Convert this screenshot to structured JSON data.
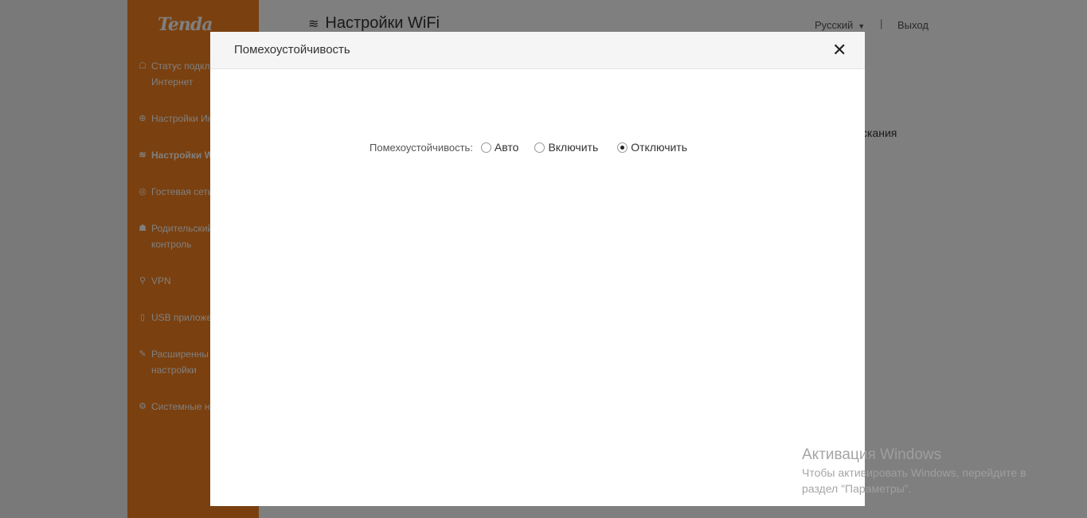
{
  "app": {
    "logo": "Tenda",
    "page_title": "Настройки WiFi",
    "language": "Русский",
    "separator": "|",
    "logout": "Выход",
    "background_fragment": "скания"
  },
  "sidebar": {
    "items": [
      {
        "icon": "network-status-icon",
        "glyph": "☖",
        "label": "Статус подкл\nИнтернет"
      },
      {
        "icon": "globe-icon",
        "glyph": "⊕",
        "label": "Настройки Ин"
      },
      {
        "icon": "wifi-icon",
        "glyph": "≋",
        "label": "Настройки W",
        "active": true
      },
      {
        "icon": "guest-network-icon",
        "glyph": "◎",
        "label": "Гостевая сеть"
      },
      {
        "icon": "parental-control-icon",
        "glyph": "☗",
        "label": "Родительский\nконтроль"
      },
      {
        "icon": "vpn-icon",
        "glyph": "⚲",
        "label": "VPN"
      },
      {
        "icon": "usb-icon",
        "glyph": "▯",
        "label": "USB приложе"
      },
      {
        "icon": "advanced-settings-icon",
        "glyph": "✎",
        "label": "Расширенны\nнастройки"
      },
      {
        "icon": "system-settings-icon",
        "glyph": "⚙",
        "label": "Системные н"
      }
    ]
  },
  "modal": {
    "title": "Помехоустойчивость",
    "close_glyph": "✕",
    "field_label": "Помехоустойчивость:",
    "options": [
      {
        "label": "Авто",
        "checked": false
      },
      {
        "label": "Включить",
        "checked": false
      },
      {
        "label": "Отключить",
        "checked": true
      }
    ]
  },
  "watermark": {
    "title": "Активация Windows",
    "line1": "Чтобы активировать Windows, перейдите в",
    "line2": "раздел \"Параметры\"."
  }
}
